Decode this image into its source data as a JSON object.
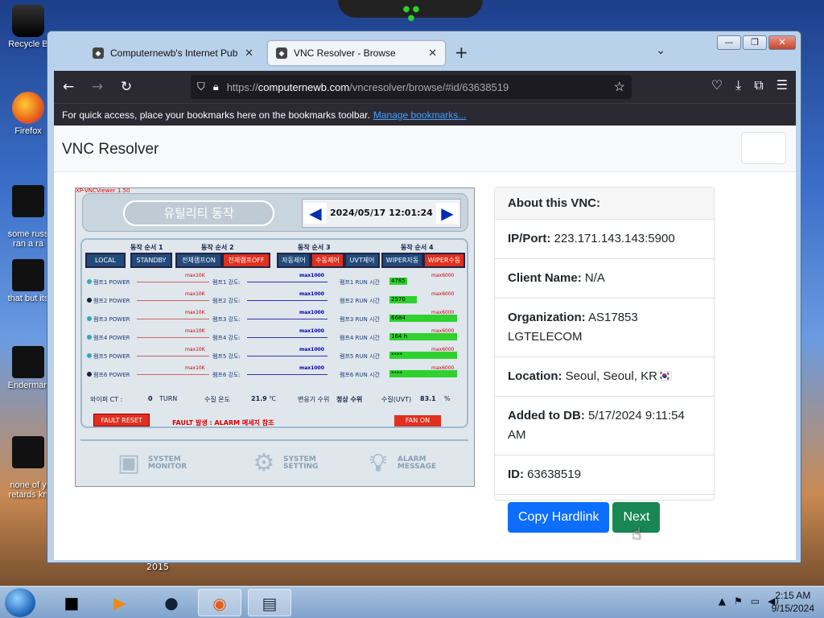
{
  "desktop": {
    "icons": [
      {
        "label": "Recycle B"
      },
      {
        "label": "Firefox"
      },
      {
        "label": "some russ\nran a ra"
      },
      {
        "label": "that but its"
      },
      {
        "label": "Enderman"
      },
      {
        "label": "none of y\nretards kn"
      }
    ],
    "year_label": "2015"
  },
  "browser": {
    "tabs": [
      {
        "label": "Computernewb's Internet Pub",
        "close": "✕"
      },
      {
        "label": "VNC Resolver - Browse",
        "close": "✕"
      }
    ],
    "new_tab": "+",
    "url_prefix": "https://",
    "url_host": "computernewb.com",
    "url_path": "/vncresolver/browse/#id/63638519",
    "bookmarks_text": "For quick access, place your bookmarks here on the bookmarks toolbar.",
    "manage_bookmarks": "Manage bookmarks..."
  },
  "page": {
    "brand": "VNC Resolver",
    "card_title": "About this VNC:",
    "fields": [
      {
        "label": "IP/Port:",
        "value": "223.171.143.143:5900"
      },
      {
        "label": "Client Name:",
        "value": "N/A"
      },
      {
        "label": "Organization:",
        "value": "AS17853 LGTELECOM"
      },
      {
        "label": "Location:",
        "value": "Seoul, Seoul, KR"
      },
      {
        "label": "Added to DB:",
        "value": "5/17/2024 9:11:54 AM"
      },
      {
        "label": "ID:",
        "value": "63638519"
      }
    ],
    "flag": "🇰🇷",
    "copy_button": "Copy Hardlink",
    "next_button": "Next"
  },
  "vnc_screen": {
    "window_title": "XP-VNCViewer 1.50",
    "title_pill": "유틸리티 동작",
    "datetime": "2024/05/17 12:01:24",
    "sequences": [
      "동작 순서 1",
      "동작 순서 2",
      "동작 순서 3",
      "동작 순서 4"
    ],
    "buttons": [
      "LOCAL",
      "STANDBY",
      "전체램프ON",
      "전체램프OFF",
      "자동제어",
      "수동제어",
      "UVT제어",
      "WIPER자동",
      "WIPER수동"
    ],
    "rows": [
      {
        "power": "램프1 POWER",
        "max1": "max10K",
        "strength": "램프1 강도:",
        "max2": "max1000",
        "run": "램프1 RUN 시간",
        "max3": "max6000",
        "value": "4785"
      },
      {
        "power": "램프2 POWER",
        "max1": "max10K",
        "strength": "램프2 강도:",
        "max2": "max1000",
        "run": "램프2 RUN 시간",
        "max3": "max6000",
        "value": "2570"
      },
      {
        "power": "램프3 POWER",
        "max1": "max10K",
        "strength": "램프3 강도:",
        "max2": "max1000",
        "run": "램프3 RUN 시간",
        "max3": "max6000",
        "value": "6684"
      },
      {
        "power": "램프4 POWER",
        "max1": "max10K",
        "strength": "램프4 강도:",
        "max2": "max1000",
        "run": "램프4 RUN 시간",
        "max3": "max6000",
        "value": "164 h"
      },
      {
        "power": "램프5 POWER",
        "max1": "max10K",
        "strength": "램프5 강도:",
        "max2": "max1000",
        "run": "램프5 RUN 시간",
        "max3": "max6000",
        "value": "****"
      },
      {
        "power": "램프6 POWER",
        "max1": "max10K",
        "strength": "램프6 강도:",
        "max2": "max1000",
        "run": "램프6 RUN 시간",
        "max3": "max6000",
        "value": "****"
      }
    ],
    "status": {
      "wiper_ct_label": "와이퍼 CT :",
      "wiper_ct_value": "0",
      "turn": "TURN",
      "water_temp_label": "수질 온도",
      "water_temp_value": "21.9",
      "water_temp_unit": "℃",
      "level_label": "변응기 수위",
      "level_value": "정상 수위",
      "uvt_label": "수질(UVT)",
      "uvt_value": "83.1",
      "uvt_unit": "%"
    },
    "fault_reset": "FAULT RESET",
    "fault_msg": "FAULT 발생 : ALARM 메세지 참조",
    "fan_on": "FAN ON",
    "bottom": [
      {
        "line1": "SYSTEM",
        "line2": "MONITOR"
      },
      {
        "line1": "SYSTEM",
        "line2": "SETTING"
      },
      {
        "line1": "ALARM",
        "line2": "MESSAGE"
      }
    ]
  },
  "taskbar": {
    "time": "2:15 AM",
    "date": "9/15/2024"
  }
}
